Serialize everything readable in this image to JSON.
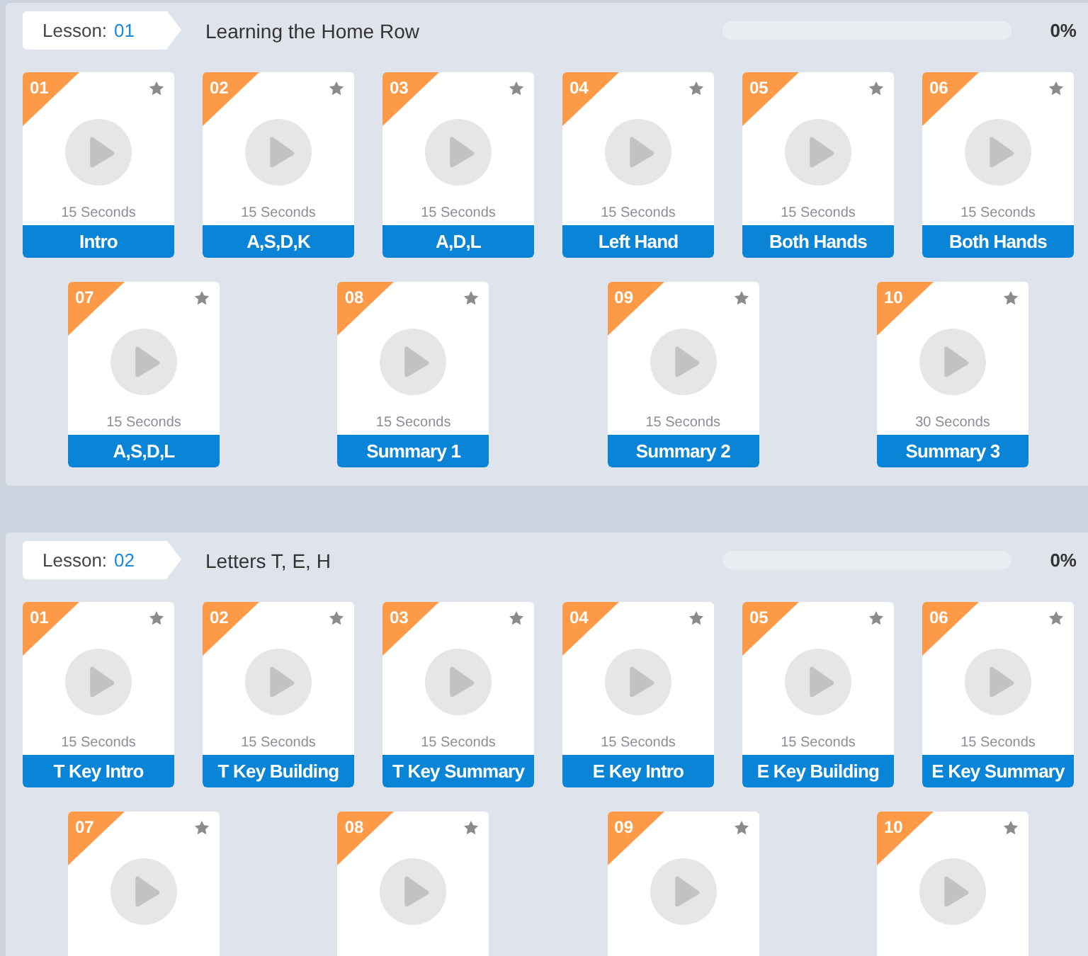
{
  "lessons": [
    {
      "label": "Lesson:",
      "number": "01",
      "title": "Learning the Home Row",
      "progress": {
        "level": 0,
        "reading": "0%"
      },
      "videos": [
        {
          "number": "01",
          "duration": "15 Seconds",
          "title": "Intro"
        },
        {
          "number": "02",
          "duration": "15 Seconds",
          "title": "A,S,D,K"
        },
        {
          "number": "03",
          "duration": "15 Seconds",
          "title": "A,D,L"
        },
        {
          "number": "04",
          "duration": "15 Seconds",
          "title": "Left Hand"
        },
        {
          "number": "05",
          "duration": "15 Seconds",
          "title": "Both Hands"
        },
        {
          "number": "06",
          "duration": "15 Seconds",
          "title": "Both Hands"
        },
        {
          "number": "07",
          "duration": "15 Seconds",
          "title": "A,S,D,L"
        },
        {
          "number": "08",
          "duration": "15 Seconds",
          "title": "Summary 1"
        },
        {
          "number": "09",
          "duration": "15 Seconds",
          "title": "Summary 2"
        },
        {
          "number": "10",
          "duration": "30 Seconds",
          "title": "Summary 3"
        }
      ]
    },
    {
      "label": "Lesson:",
      "number": "02",
      "title": "Letters T, E, H",
      "progress": {
        "level": 0,
        "reading": "0%"
      },
      "videos": [
        {
          "number": "01",
          "duration": "15 Seconds",
          "title": "T Key Intro"
        },
        {
          "number": "02",
          "duration": "15 Seconds",
          "title": "T Key Building"
        },
        {
          "number": "03",
          "duration": "15 Seconds",
          "title": "T Key Summary"
        },
        {
          "number": "04",
          "duration": "15 Seconds",
          "title": "E Key Intro"
        },
        {
          "number": "05",
          "duration": "15 Seconds",
          "title": "E Key Building"
        },
        {
          "number": "06",
          "duration": "15 Seconds",
          "title": "E Key Summary"
        },
        {
          "number": "07"
        },
        {
          "number": "08"
        },
        {
          "number": "09"
        },
        {
          "number": "10"
        }
      ]
    }
  ]
}
